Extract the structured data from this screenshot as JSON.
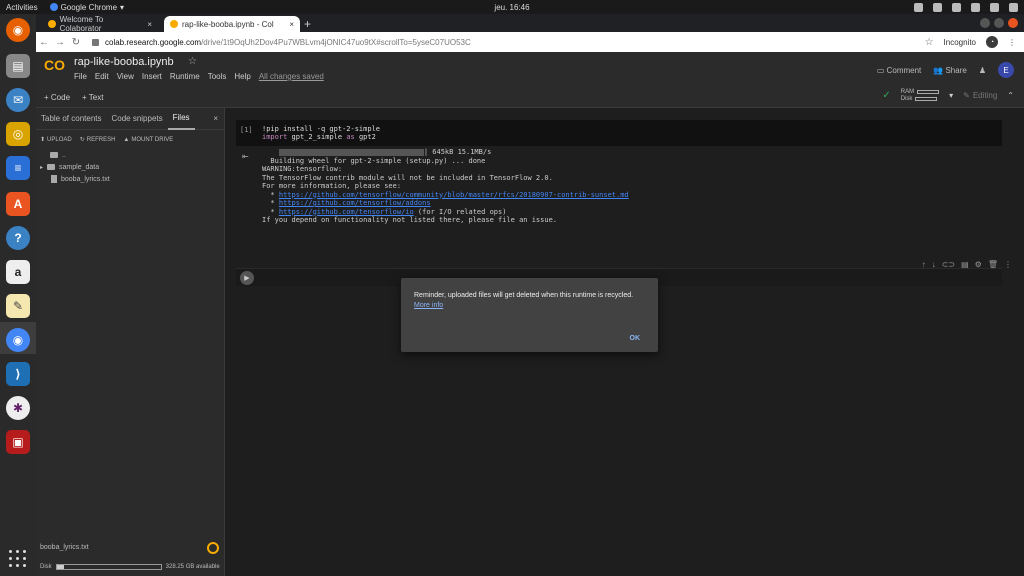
{
  "topbar": {
    "activities": "Activities",
    "app_name": "Google Chrome",
    "clock": "jeu. 16:46"
  },
  "chrome": {
    "tabs": [
      {
        "title": "Welcome To Colaborator",
        "active": false
      },
      {
        "title": "rap-like-booba.ipynb - Col",
        "active": true
      }
    ],
    "url_host": "colab.research.google.com",
    "url_path": "/drive/1t9OqUh2Dov4Pu7WBLvm4jONIC47uo9tX#scrollTo=5yseC07UO53C",
    "incognito": "Incognito"
  },
  "colab": {
    "notebook_title": "rap-like-booba.ipynb",
    "menu": [
      "File",
      "Edit",
      "View",
      "Insert",
      "Runtime",
      "Tools",
      "Help"
    ],
    "saved_status": "All changes saved",
    "comment": "Comment",
    "share": "Share",
    "user_initial": "E",
    "toolbar": {
      "add_code": "+ Code",
      "add_text": "+ Text",
      "ram": "RAM",
      "disk": "Disk",
      "editing": "Editing"
    }
  },
  "sidebar": {
    "tabs": [
      "Table of contents",
      "Code snippets",
      "Files"
    ],
    "actions": [
      "UPLOAD",
      "REFRESH",
      "MOUNT DRIVE"
    ],
    "tree": [
      {
        "name": "..",
        "type": "folder"
      },
      {
        "name": "sample_data",
        "type": "folder"
      },
      {
        "name": "booba_lyrics.txt",
        "type": "file"
      }
    ],
    "bottom_file": "booba_lyrics.txt",
    "disk_label": "Disk",
    "disk_available": "328.25 GB available",
    "disk_used_fraction": 0.07
  },
  "notebook": {
    "cell1": {
      "exec_count": "[1]",
      "line1": "!pip install -q gpt-2-simple",
      "line2_kw1": "import",
      "line2_mod": " gpt_2_simple ",
      "line2_kw2": "as",
      "line2_alias": " gpt2"
    },
    "output": {
      "progress_text": "| 645kB 15.1MB/s",
      "lines": [
        "  Building wheel for gpt-2-simple (setup.py) ... done",
        "WARNING:tensorflow:",
        "The TensorFlow contrib module will not be included in TensorFlow 2.0.",
        "For more information, please see:"
      ],
      "links": [
        "https://github.com/tensorflow/community/blob/master/rfcs/20180907-contrib-sunset.md",
        "https://github.com/tensorflow/addons",
        "https://github.com/tensorflow/io"
      ],
      "io_suffix": " (for I/O related ops)",
      "last_line": "If you depend on functionality not listed there, please file an issue."
    }
  },
  "dialog": {
    "message": "Reminder, uploaded files will get deleted when this runtime is recycled.",
    "link": "More info",
    "ok": "OK"
  }
}
